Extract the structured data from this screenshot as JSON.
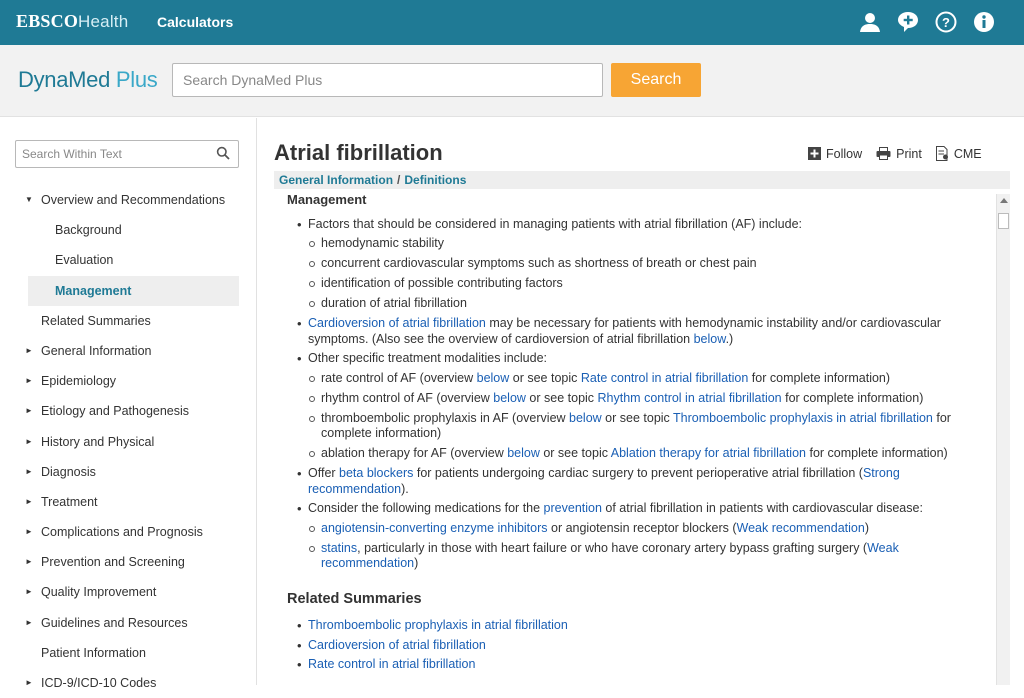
{
  "topbar": {
    "brand_bold": "EBSCO",
    "brand_light": "Health",
    "nav_calculators": "Calculators",
    "icons": [
      "user-icon",
      "chat-plus-icon",
      "help-icon",
      "info-icon"
    ]
  },
  "header": {
    "logo_main": "DynaMed",
    "logo_plus": " Plus",
    "search_placeholder": "Search DynaMed Plus",
    "search_button": "Search"
  },
  "sidebar": {
    "within_placeholder": "Search Within Text",
    "items": [
      {
        "label": "Overview and Recommendations",
        "arrow": "▼"
      },
      {
        "label": "Background"
      },
      {
        "label": "Evaluation"
      },
      {
        "label": "Management"
      },
      {
        "label": "Related Summaries"
      },
      {
        "label": "General Information",
        "arrow": "►"
      },
      {
        "label": "Epidemiology",
        "arrow": "►"
      },
      {
        "label": "Etiology and Pathogenesis",
        "arrow": "►"
      },
      {
        "label": "History and Physical",
        "arrow": "►"
      },
      {
        "label": "Diagnosis",
        "arrow": "►"
      },
      {
        "label": "Treatment",
        "arrow": "►"
      },
      {
        "label": "Complications and Prognosis",
        "arrow": "►"
      },
      {
        "label": "Prevention and Screening",
        "arrow": "►"
      },
      {
        "label": "Quality Improvement",
        "arrow": "►"
      },
      {
        "label": "Guidelines and Resources",
        "arrow": "►"
      },
      {
        "label": "Patient Information"
      },
      {
        "label": "ICD-9/ICD-10 Codes",
        "arrow": "►"
      }
    ]
  },
  "main": {
    "title": "Atrial fibrillation",
    "actions": {
      "follow": "Follow",
      "print": "Print",
      "cme": "CME"
    },
    "breadcrumb": [
      "General Information",
      "/",
      "Definitions"
    ],
    "section_heading": "Management",
    "b1": "Factors that should be considered in managing patients with atrial fibrillation (AF) include:",
    "b1_sub": [
      "hemodynamic stability",
      "concurrent cardiovascular symptoms such as shortness of breath or chest pain",
      "identification of possible contributing factors",
      "duration of atrial fibrillation"
    ],
    "b2_link": "Cardioversion of atrial fibrillation",
    "b2_text": " may be necessary for patients with hemodynamic instability and/or cardiovascular symptoms. (Also see the overview of cardioversion of atrial fibrillation ",
    "b2_below": "below",
    "b2_end": ".)",
    "b3": "Other specific treatment modalities include:",
    "s1_a": "rate control of AF (overview ",
    "s1_below": "below",
    "s1_b": " or see topic ",
    "s1_link": "Rate control in atrial fibrillation",
    "s1_c": " for complete information)",
    "s2_a": "rhythm control of AF (overview ",
    "s2_below": "below",
    "s2_b": " or see topic ",
    "s2_link": "Rhythm control in atrial fibrillation",
    "s2_c": " for complete information)",
    "s3_a": "thromboembolic prophylaxis in AF (overview ",
    "s3_below": "below",
    "s3_b": " or see topic ",
    "s3_link": "Thromboembolic prophylaxis in atrial fibrillation",
    "s3_c": " for complete information)",
    "s4_a": "ablation therapy for AF (overview ",
    "s4_below": "below",
    "s4_b": " or see topic ",
    "s4_link": "Ablation therapy for atrial fibrillation",
    "s4_c": " for complete information)",
    "b4_a": "Offer ",
    "b4_link": "beta blockers",
    "b4_b": " for patients undergoing cardiac surgery to prevent perioperative atrial fibrillation (",
    "b4_rec": "Strong recommendation",
    "b4_c": ").",
    "b5_a": "Consider the following medications for the ",
    "b5_link": "prevention",
    "b5_b": " of atrial fibrillation in patients with cardiovascular disease:",
    "m1_link": "angiotensin-converting enzyme inhibitors",
    "m1_a": " or angiotensin receptor blockers (",
    "m1_rec": "Weak recommendation",
    "m1_b": ")",
    "m2_link": "statins",
    "m2_a": ", particularly in those with heart failure or who have coronary artery bypass grafting surgery (",
    "m2_rec": "Weak recommendation",
    "m2_b": ")",
    "related_heading": "Related Summaries",
    "related": [
      "Thromboembolic prophylaxis in atrial fibrillation",
      "Cardioversion of atrial fibrillation",
      "Rate control in atrial fibrillation"
    ]
  }
}
